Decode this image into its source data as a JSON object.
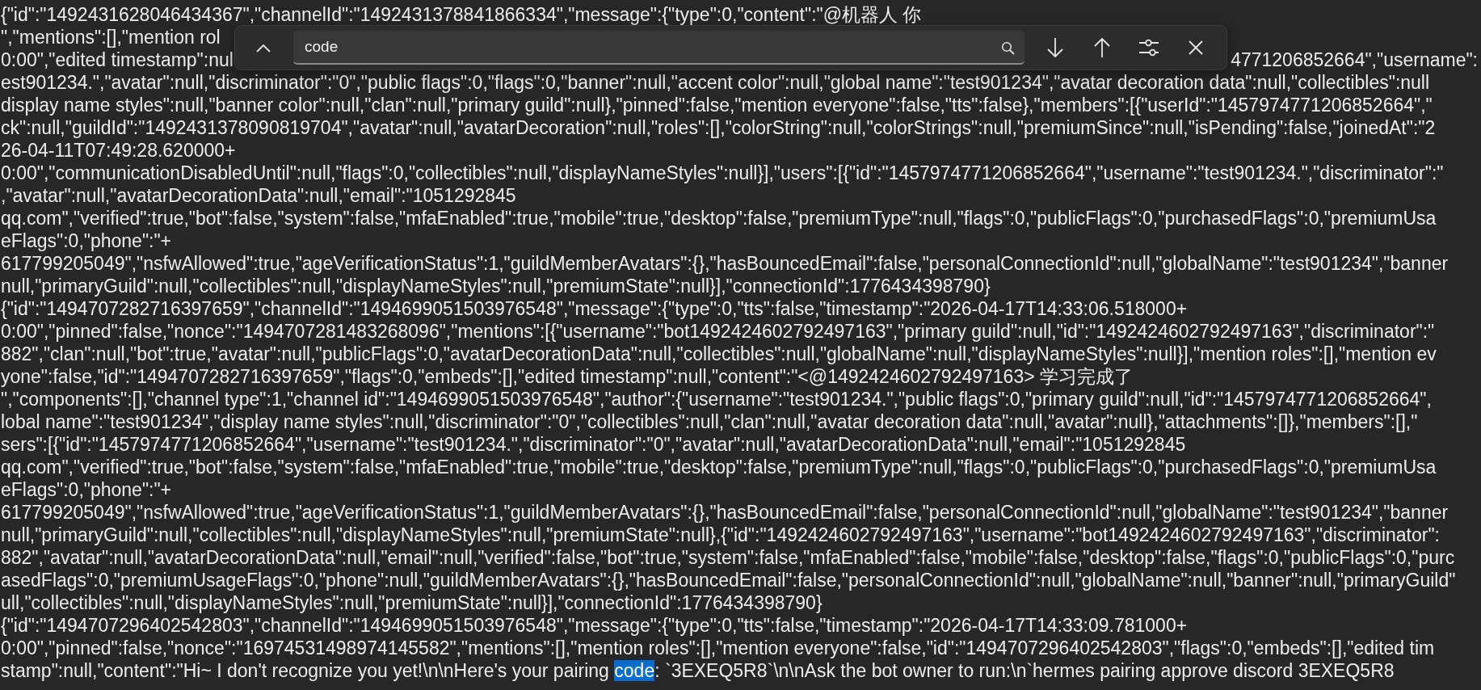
{
  "find_bar": {
    "query": "code"
  },
  "log_lines": [
    {
      "text": "{\"id\":\"1492431628046434367\",\"channelId\":\"1492431378841866334\",\"message\":{\"type\":0,\"content\":\"@机器人 你"
    },
    {
      "text": "\",\"mentions\":[],\"mention rol"
    },
    {
      "text": "0:00\",\"edited timestamp\":nul",
      "text_right": "4771206852664\",\"username\":"
    },
    {
      "text": "est901234.\",\"avatar\":null,\"discriminator\":\"0\",\"public flags\":0,\"flags\":0,\"banner\":null,\"accent color\":null,\"global name\":\"test901234\",\"avatar decoration data\":null,\"collectibles\":null"
    },
    {
      "text": "display name styles\":null,\"banner color\":null,\"clan\":null,\"primary guild\":null},\"pinned\":false,\"mention everyone\":false,\"tts\":false},\"members\":[{\"userId\":\"1457974771206852664\",\""
    },
    {
      "text": "ck\":null,\"guildId\":\"1492431378090819704\",\"avatar\":null,\"avatarDecoration\":null,\"roles\":[],\"colorString\":null,\"colorStrings\":null,\"premiumSince\":null,\"isPending\":false,\"joinedAt\":\"2"
    },
    {
      "text": "26-04-11T07:49:28.620000+"
    },
    {
      "text": "0:00\",\"communicationDisabledUntil\":null,\"flags\":0,\"collectibles\":null,\"displayNameStyles\":null}],\"users\":[{\"id\":\"1457974771206852664\",\"username\":\"test901234.\",\"discriminator\":\""
    },
    {
      "text": ",\"avatar\":null,\"avatarDecorationData\":null,\"email\":\"1051292845"
    },
    {
      "text": "qq.com\",\"verified\":true,\"bot\":false,\"system\":false,\"mfaEnabled\":true,\"mobile\":true,\"desktop\":false,\"premiumType\":null,\"flags\":0,\"publicFlags\":0,\"purchasedFlags\":0,\"premiumUsa"
    },
    {
      "text": "eFlags\":0,\"phone\":\"+"
    },
    {
      "text": "617799205049\",\"nsfwAllowed\":true,\"ageVerificationStatus\":1,\"guildMemberAvatars\":{},\"hasBouncedEmail\":false,\"personalConnectionId\":null,\"globalName\":\"test901234\",\"banner"
    },
    {
      "text": "null,\"primaryGuild\":null,\"collectibles\":null,\"displayNameStyles\":null,\"premiumState\":null}],\"connectionId\":1776434398790}"
    },
    {
      "text": "{\"id\":\"1494707282716397659\",\"channelId\":\"1494699051503976548\",\"message\":{\"type\":0,\"tts\":false,\"timestamp\":\"2026-04-17T14:33:06.518000+"
    },
    {
      "text": "0:00\",\"pinned\":false,\"nonce\":\"1494707281483268096\",\"mentions\":[{\"username\":\"bot1492424602792497163\",\"primary guild\":null,\"id\":\"1492424602792497163\",\"discriminator\":\""
    },
    {
      "text": "882\",\"clan\":null,\"bot\":true,\"avatar\":null,\"publicFlags\":0,\"avatarDecorationData\":null,\"collectibles\":null,\"globalName\":null,\"displayNameStyles\":null}],\"mention roles\":[],\"mention ev"
    },
    {
      "text": "yone\":false,\"id\":\"1494707282716397659\",\"flags\":0,\"embeds\":[],\"edited timestamp\":null,\"content\":\"<@1492424602792497163> 学习完成了"
    },
    {
      "text": "\",\"components\":[],\"channel type\":1,\"channel id\":\"1494699051503976548\",\"author\":{\"username\":\"test901234.\",\"public flags\":0,\"primary guild\":null,\"id\":\"1457974771206852664\","
    },
    {
      "text": "lobal name\":\"test901234\",\"display name styles\":null,\"discriminator\":\"0\",\"collectibles\":null,\"clan\":null,\"avatar decoration data\":null,\"avatar\":null},\"attachments\":[]},\"members\":[],\""
    },
    {
      "text": "sers\":[{\"id\":\"1457974771206852664\",\"username\":\"test901234.\",\"discriminator\":\"0\",\"avatar\":null,\"avatarDecorationData\":null,\"email\":\"1051292845"
    },
    {
      "text": "qq.com\",\"verified\":true,\"bot\":false,\"system\":false,\"mfaEnabled\":true,\"mobile\":true,\"desktop\":false,\"premiumType\":null,\"flags\":0,\"publicFlags\":0,\"purchasedFlags\":0,\"premiumUsa"
    },
    {
      "text": "eFlags\":0,\"phone\":\"+"
    },
    {
      "text": "617799205049\",\"nsfwAllowed\":true,\"ageVerificationStatus\":1,\"guildMemberAvatars\":{},\"hasBouncedEmail\":false,\"personalConnectionId\":null,\"globalName\":\"test901234\",\"banner"
    },
    {
      "text": "null,\"primaryGuild\":null,\"collectibles\":null,\"displayNameStyles\":null,\"premiumState\":null},{\"id\":\"1492424602792497163\",\"username\":\"bot1492424602792497163\",\"discriminator\":"
    },
    {
      "text": "882\",\"avatar\":null,\"avatarDecorationData\":null,\"email\":null,\"verified\":false,\"bot\":true,\"system\":false,\"mfaEnabled\":false,\"mobile\":false,\"desktop\":false,\"flags\":0,\"publicFlags\":0,\"purc"
    },
    {
      "text": "asedFlags\":0,\"premiumUsageFlags\":0,\"phone\":null,\"guildMemberAvatars\":{},\"hasBouncedEmail\":false,\"personalConnectionId\":null,\"globalName\":null,\"banner\":null,\"primaryGuild\""
    },
    {
      "text": "ull,\"collectibles\":null,\"displayNameStyles\":null,\"premiumState\":null}],\"connectionId\":1776434398790}"
    },
    {
      "text": "{\"id\":\"1494707296402542803\",\"channelId\":\"1494699051503976548\",\"message\":{\"type\":0,\"tts\":false,\"timestamp\":\"2026-04-17T14:33:09.781000+"
    },
    {
      "text": "0:00\",\"pinned\":false,\"nonce\":\"16974531498974145582\",\"mentions\":[],\"mention roles\":[],\"mention everyone\":false,\"id\":\"1494707296402542803\",\"flags\":0,\"embeds\":[],\"edited tim"
    },
    {
      "text": "stamp\":null,\"content\":\"Hi~ I don't recognize you yet!\\n\\nHere's your pairing ",
      "match": "code",
      "after": ": `3EXEQ5R8`\\n\\nAsk the bot owner to run:\\n`hermes pairing approve discord 3EXEQ5R8"
    }
  ]
}
